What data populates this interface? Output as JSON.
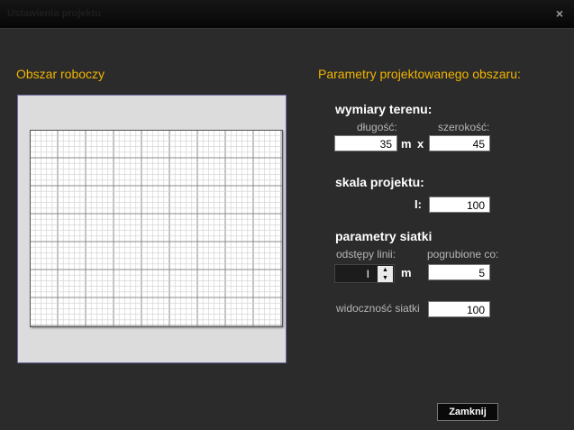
{
  "window": {
    "title": "Ustawienia projektu",
    "close_glyph": "×"
  },
  "left": {
    "heading": "Obszar roboczy"
  },
  "right": {
    "heading": "Parametry projektowanego obszaru:",
    "terrain": {
      "title": "wymiary terenu:",
      "length_label": "długość:",
      "width_label": "szerokość:",
      "length_value": "35",
      "unit_m": "m",
      "times": "x",
      "width_value": "45"
    },
    "scale": {
      "title": "skala projektu:",
      "prefix": "I:",
      "value": "100"
    },
    "grid": {
      "title": "parametry siatki",
      "spacing_label": "odstępy linii:",
      "bold_label": "pogrubione co:",
      "spacing_value": "I",
      "unit_m": "m",
      "bold_value": "5",
      "visibility_label": "widoczność siatki",
      "visibility_value": "100"
    }
  },
  "footer": {
    "close_button": "Zamknij"
  },
  "icons": {
    "close": "close-icon",
    "up": "chevron-up-icon",
    "down": "chevron-down-icon"
  }
}
